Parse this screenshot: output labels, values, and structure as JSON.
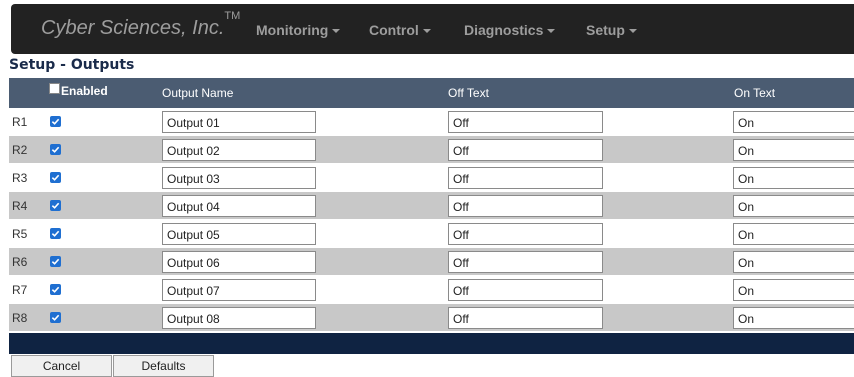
{
  "navbar": {
    "brand": "Cyber Sciences, Inc.",
    "trademark": "TM",
    "menus": [
      "Monitoring",
      "Control",
      "Diagnostics",
      "Setup"
    ]
  },
  "page": {
    "title": "Setup - Outputs"
  },
  "table": {
    "headers": {
      "enabled": "Enabled",
      "output_name": "Output Name",
      "off_text": "Off Text",
      "on_text": "On Text"
    },
    "rows": [
      {
        "label": "R1",
        "enabled": true,
        "name": "Output 01",
        "off": "Off",
        "on": "On"
      },
      {
        "label": "R2",
        "enabled": true,
        "name": "Output 02",
        "off": "Off",
        "on": "On"
      },
      {
        "label": "R3",
        "enabled": true,
        "name": "Output 03",
        "off": "Off",
        "on": "On"
      },
      {
        "label": "R4",
        "enabled": true,
        "name": "Output 04",
        "off": "Off",
        "on": "On"
      },
      {
        "label": "R5",
        "enabled": true,
        "name": "Output 05",
        "off": "Off",
        "on": "On"
      },
      {
        "label": "R6",
        "enabled": true,
        "name": "Output 06",
        "off": "Off",
        "on": "On"
      },
      {
        "label": "R7",
        "enabled": true,
        "name": "Output 07",
        "off": "Off",
        "on": "On"
      },
      {
        "label": "R8",
        "enabled": true,
        "name": "Output 08",
        "off": "Off",
        "on": "On"
      }
    ]
  },
  "buttons": {
    "cancel": "Cancel",
    "defaults": "Defaults"
  },
  "colors": {
    "navbar_bg": "#222222",
    "header_bg": "#4b5c72",
    "footer_bar": "#0f2342",
    "row_alt": "#c8c8c8",
    "checkbox_accent": "#1f6fd1"
  }
}
